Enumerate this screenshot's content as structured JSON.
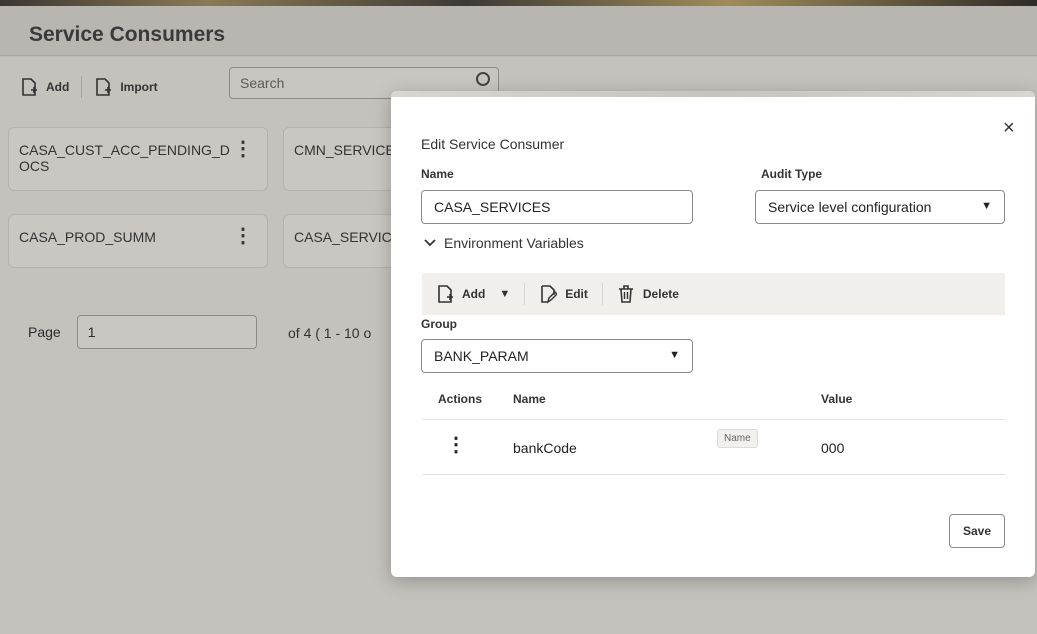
{
  "page": {
    "title": "Service Consumers"
  },
  "toolbar": {
    "add_label": "Add",
    "import_label": "Import",
    "search_placeholder": "Search"
  },
  "cards": [
    {
      "label": "CASA_CUST_ACC_PENDING_D OCS"
    },
    {
      "label": "CMN_SERVICE"
    },
    {
      "label": "CASA_PROD_SUMM"
    },
    {
      "label": "CASA_SERVIC"
    }
  ],
  "pager": {
    "label": "Page",
    "value": "1",
    "of_text": "of 4   ( 1 - 10 o"
  },
  "dialog": {
    "title": "Edit Service Consumer",
    "close_glyph": "×",
    "name_label": "Name",
    "name_value": "CASA_SERVICES",
    "audit_label": "Audit Type",
    "audit_value": "Service level configuration",
    "env_label": "Environment Variables",
    "env_toolbar": {
      "add_label": "Add",
      "edit_label": "Edit",
      "delete_label": "Delete"
    },
    "group_label": "Group",
    "group_value": "BANK_PARAM",
    "table": {
      "headers": [
        "Actions",
        "Name",
        "Value"
      ],
      "rows": [
        {
          "actions": "⋮",
          "name": "bankCode",
          "value": "000"
        }
      ]
    },
    "tooltip": "Name",
    "save_label": "Save"
  }
}
